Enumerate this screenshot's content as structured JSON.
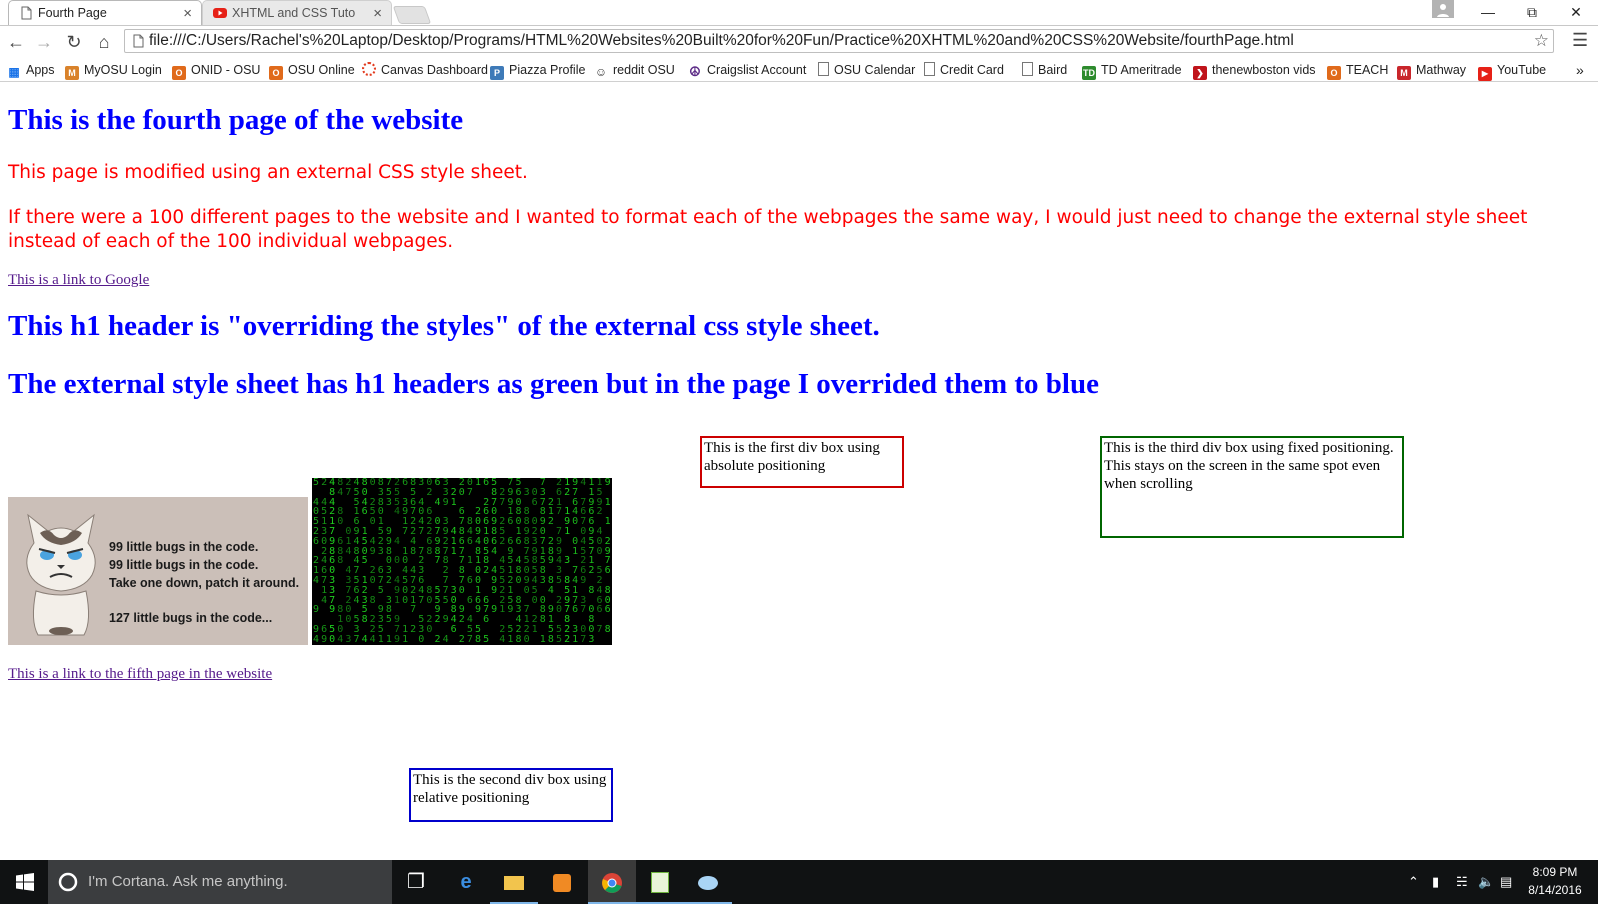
{
  "browser": {
    "tabs": [
      {
        "title": "Fourth Page",
        "active": true,
        "icon": "page-icon"
      },
      {
        "title": "XHTML and CSS Tutorial -",
        "active": false,
        "icon": "youtube-icon"
      }
    ],
    "close_glyph": "×",
    "url": "file:///C:/Users/Rachel's%20Laptop/Desktop/Programs/HTML%20Websites%20Built%20for%20Fun/Practice%20XHTML%20and%20CSS%20Website/fourthPage.html",
    "bookmarks": [
      {
        "label": "Apps",
        "icon": "apps-grid-icon"
      },
      {
        "label": "MyOSU Login",
        "icon": "myosu-icon"
      },
      {
        "label": "ONID - OSU",
        "icon": "osu-icon"
      },
      {
        "label": "OSU Online",
        "icon": "osu-icon"
      },
      {
        "label": "Canvas Dashboard",
        "icon": "canvas-icon"
      },
      {
        "label": "Piazza Profile",
        "icon": "piazza-icon"
      },
      {
        "label": "reddit OSU",
        "icon": "reddit-icon"
      },
      {
        "label": "Craigslist Account",
        "icon": "peace-icon"
      },
      {
        "label": "OSU Calendar",
        "icon": "page-icon"
      },
      {
        "label": "Credit Card",
        "icon": "page-icon"
      },
      {
        "label": "Baird",
        "icon": "page-icon"
      },
      {
        "label": "TD Ameritrade",
        "icon": "td-icon"
      },
      {
        "label": "thenewboston vids",
        "icon": "thenewboston-icon"
      },
      {
        "label": "TEACH",
        "icon": "osu-coe-icon"
      },
      {
        "label": "Mathway",
        "icon": "mathway-icon"
      },
      {
        "label": "YouTube",
        "icon": "youtube-icon"
      }
    ],
    "overflow_glyph": "»"
  },
  "page": {
    "heading_main": "This is the fourth page of the website",
    "para1": "This page is modified using an external CSS style sheet.",
    "para2": "If there were a 100 different pages to the website and I wanted to format each of the webpages the same way, I would just need to change the external style sheet instead of each of the 100 individual webpages.",
    "link_google": "This is a link to Google",
    "heading_override1": "This h1 header is \"overriding the styles\" of the external css style sheet.",
    "heading_override2": "The external style sheet has h1 headers as green but in the page I overrided them to blue",
    "div_first": "This is the first div box using absolute positioning",
    "div_third": "This is the third div box using fixed positioning. This stays on the screen in the same spot even when scrolling",
    "div_second": "This is the second div box using relative positioning",
    "link_fifth": "This is a link to the fifth page in the website",
    "cat_image": {
      "lines": [
        "99 little bugs in the code.",
        "99 little bugs in the code.",
        "Take one down, patch it around.",
        "127 little bugs in the code..."
      ]
    },
    "matrix_image": {
      "chars": "0123456789"
    }
  },
  "colors": {
    "heading": "#0000ff",
    "paragraph": "#ff0000",
    "visited_link": "#551a8b",
    "div_first_border": "#cc0000",
    "div_third_border": "#006600",
    "div_second_border": "#0000cc",
    "matrix_green": "#1fd11f"
  },
  "taskbar": {
    "search_placeholder": "I'm Cortana. Ask me anything.",
    "apps": [
      "task-view-icon",
      "edge-icon",
      "file-explorer-icon",
      "media-player-icon",
      "chrome-icon",
      "notepad-plus-icon",
      "paint-icon"
    ],
    "time": "8:09 PM",
    "date": "8/14/2016"
  }
}
